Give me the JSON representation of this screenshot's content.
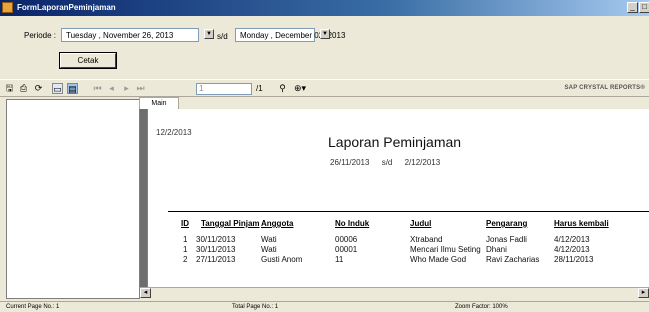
{
  "window": {
    "title": "FormLaporanPeminjaman",
    "minimize": "_",
    "maximize": "□"
  },
  "form": {
    "periode_label": "Periode :",
    "start_date": "Tuesday   , November 26, 2013",
    "end_date": "Monday   , December 02, 2013",
    "sd_label": "s/d",
    "cetak_label": "Cetak"
  },
  "toolbar": {
    "page_value": "1",
    "page_total": "/1",
    "brand": "SAP CRYSTAL REPORTS®"
  },
  "viewer": {
    "tab_label": "Main Report"
  },
  "report": {
    "print_date": "12/2/2013",
    "title": "Laporan Peminjaman",
    "period_from": "26/11/2013",
    "period_sd": "s/d",
    "period_to": "2/12/2013",
    "columns": [
      "ID",
      "Tanggal Pinjam",
      "Anggota",
      "No Induk",
      "Judul",
      "Pengarang",
      "Harus kembali"
    ],
    "rows": [
      [
        "1",
        "30/11/2013",
        "Wati",
        "00006",
        "Xtraband",
        "Jonas Fadli",
        "4/12/2013"
      ],
      [
        "1",
        "30/11/2013",
        "Wati",
        "00001",
        "Mencari Ilmu Seting",
        "Dhani",
        "4/12/2013"
      ],
      [
        "2",
        "27/11/2013",
        "Gusti Anom",
        "11",
        "Who Made God",
        "Ravi Zacharias",
        "28/11/2013"
      ]
    ]
  },
  "status": {
    "current_page": "Current Page No.: 1",
    "total_page": "Total Page No.: 1",
    "zoom": "Zoom Factor: 100%"
  }
}
